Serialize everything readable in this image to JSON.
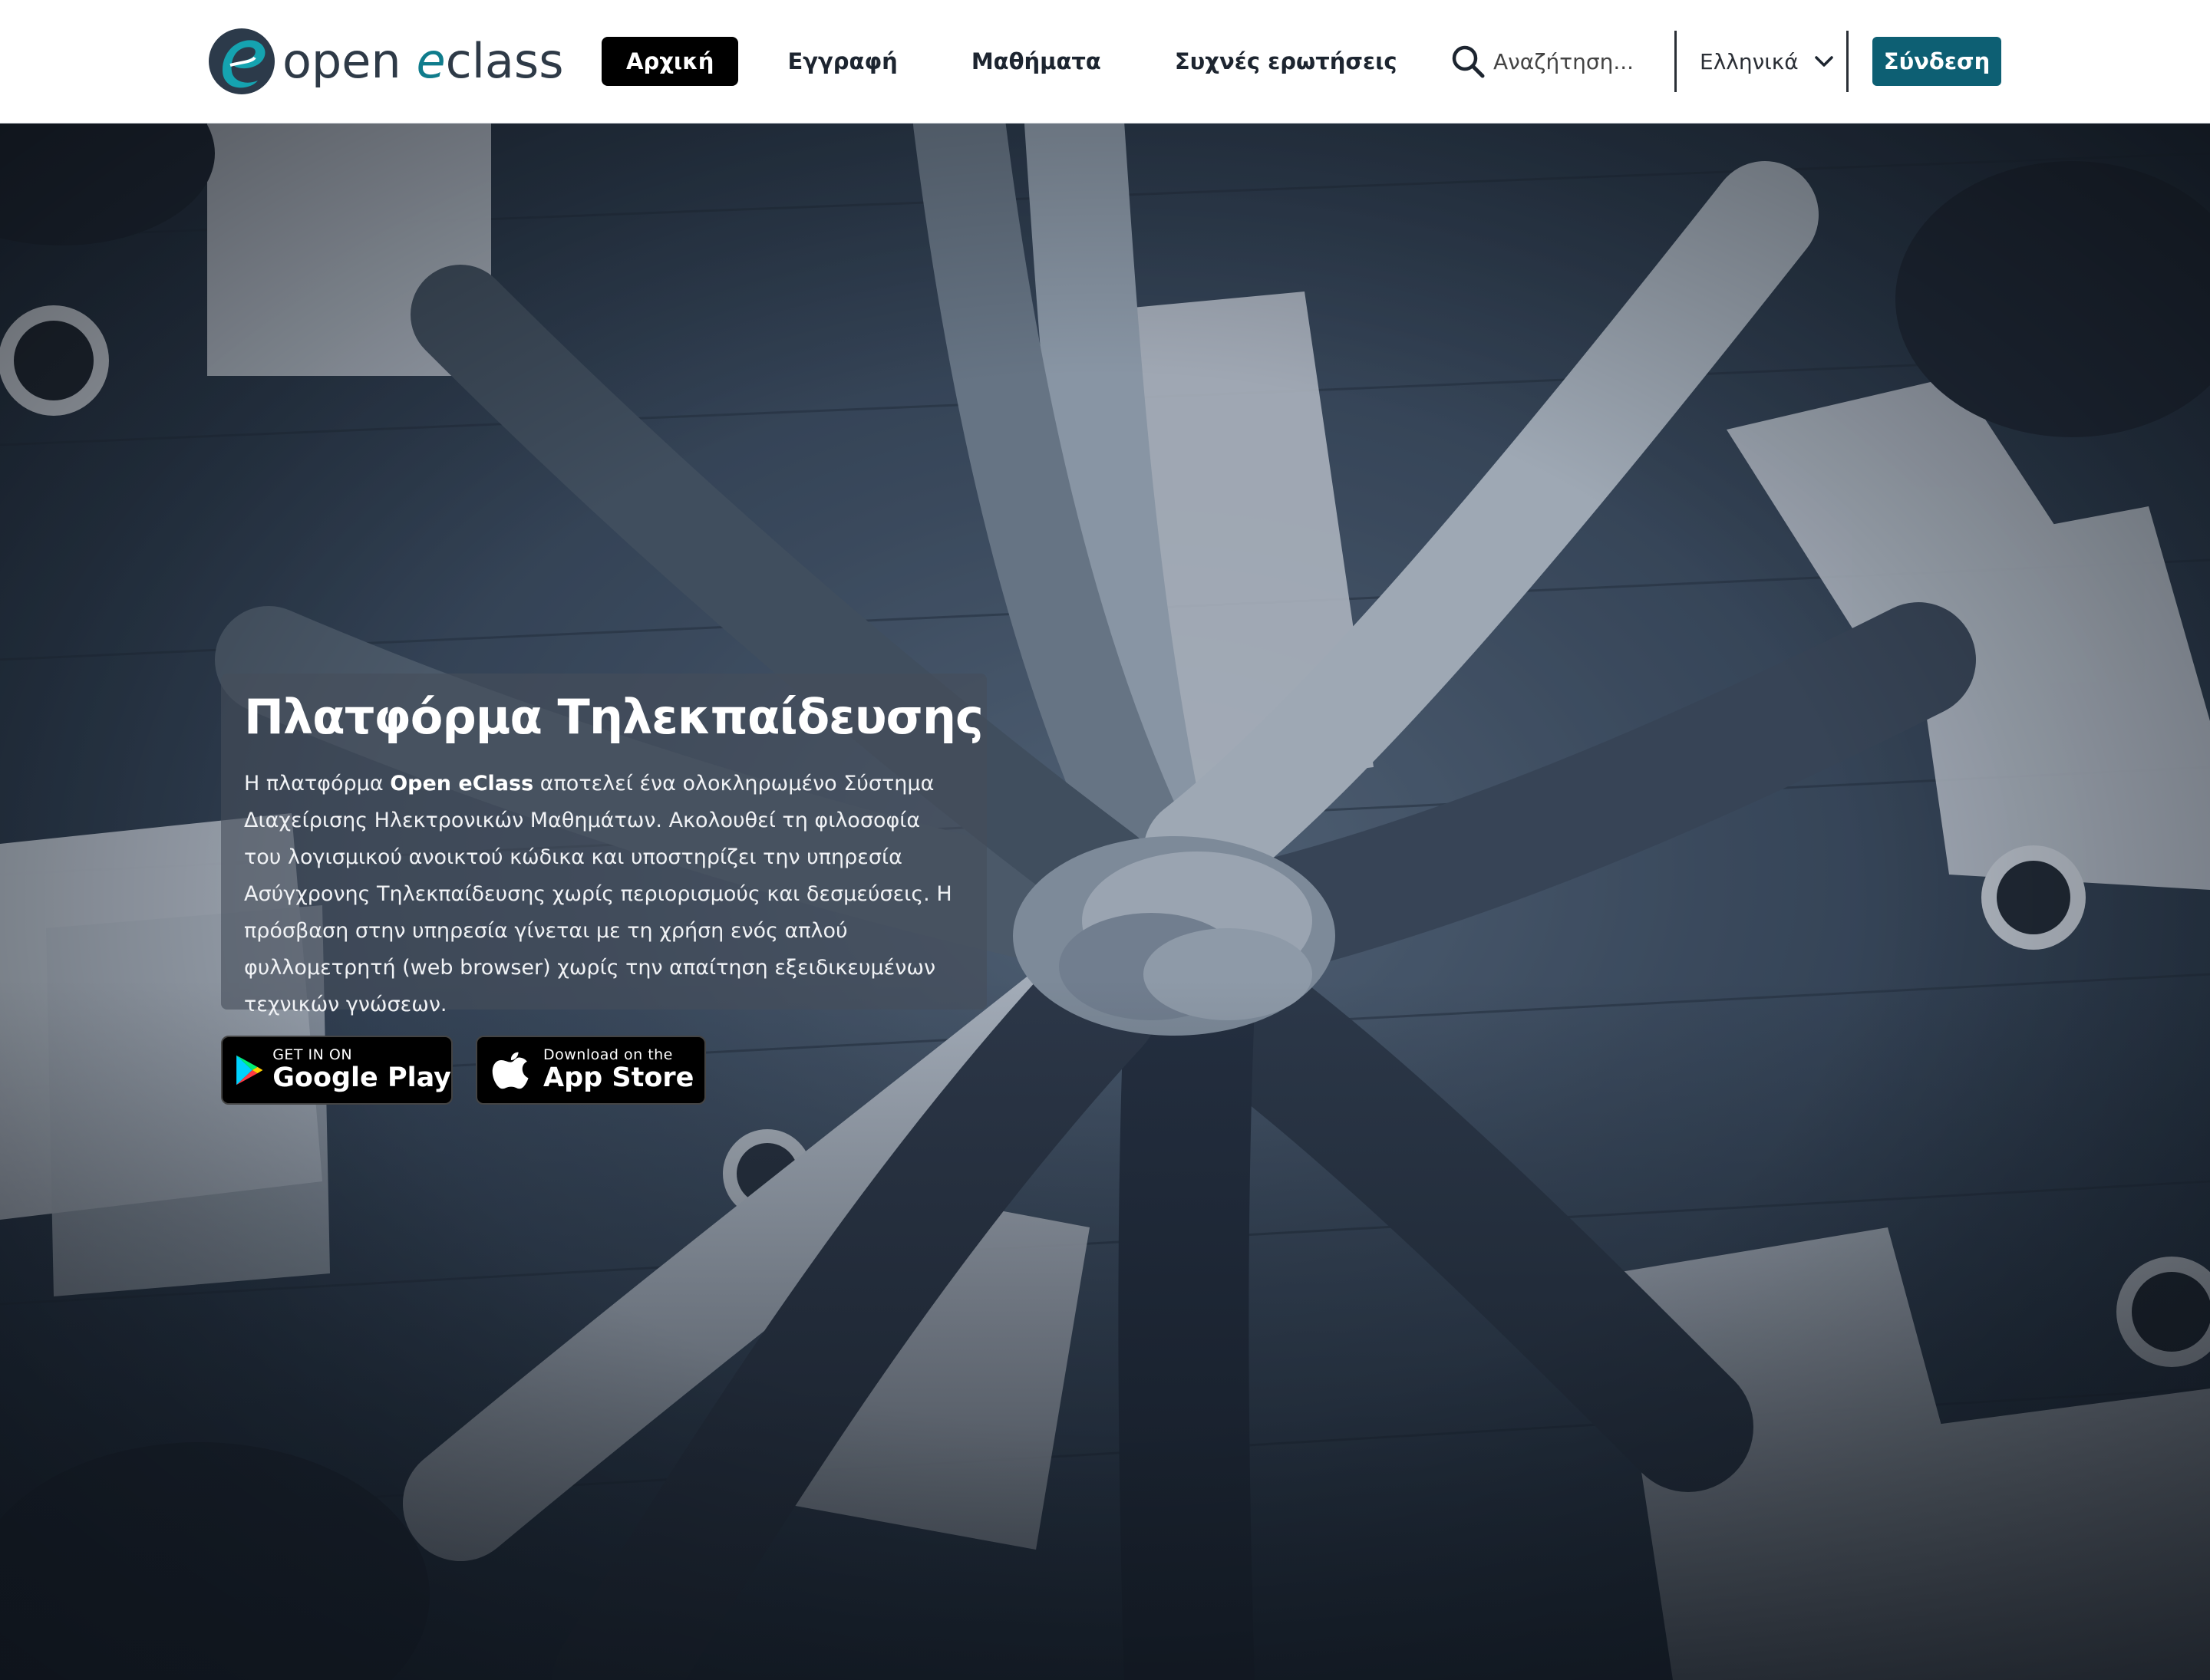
{
  "header": {
    "logo": {
      "word1": "open",
      "word2": "e",
      "word3": "class"
    },
    "nav": [
      {
        "label": "Αρχική",
        "active": true
      },
      {
        "label": "Εγγραφή",
        "active": false
      },
      {
        "label": "Μαθήματα",
        "active": false
      },
      {
        "label": "Συχνές ερωτήσεις",
        "active": false
      }
    ],
    "search": {
      "placeholder": "Αναζήτηση..."
    },
    "language": {
      "label": "Ελληνικά"
    },
    "login_label": "Σύνδεση"
  },
  "hero": {
    "title": "Πλατφόρμα Τηλεκπαίδευσης",
    "text_before": "Η πλατφόρμα ",
    "text_bold": "Open eClass",
    "text_after": " αποτελεί ένα ολοκληρωμένο Σύστημα Διαχείρισης Ηλεκτρονικών Μαθημάτων. Ακολουθεί τη φιλοσοφία του λογισμικού ανοικτού κώδικα και υποστηρίζει την υπηρεσία Ασύγχρονης Τηλεκπαίδευσης χωρίς περιορισμούς και δεσμεύσεις. Η πρόσβαση στην υπηρεσία γίνεται με τη χρήση ενός απλού φυλλομετρητή (web browser) χωρίς την απαίτηση εξειδικευμένων τεχνικών γνώσεων.",
    "google_play": {
      "small": "GET IN ON",
      "big": "Google Play"
    },
    "app_store": {
      "small": "Download on the",
      "big": "App Store"
    }
  },
  "colors": {
    "accent": "#0d5f73",
    "logo_teal": "#0f7c8c",
    "nav_active_bg": "#000000"
  },
  "icons": {
    "search": "search-icon",
    "language": "chevron-down-icon",
    "google_play": "google-play-icon",
    "app_store": "apple-icon"
  }
}
